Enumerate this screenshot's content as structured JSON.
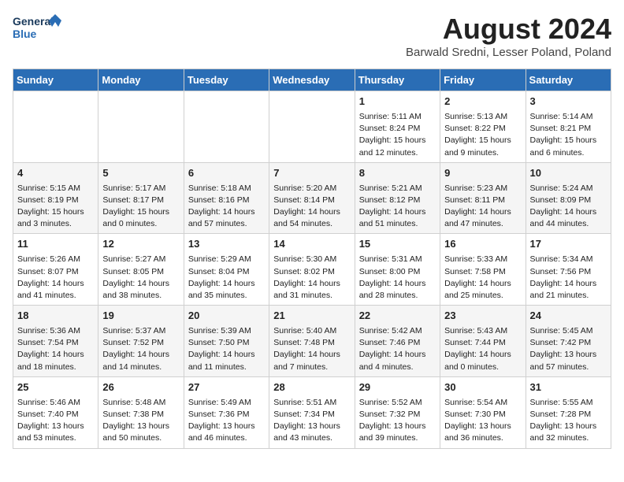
{
  "header": {
    "logo_line1": "General",
    "logo_line2": "Blue",
    "month_title": "August 2024",
    "location": "Barwald Sredni, Lesser Poland, Poland"
  },
  "days_of_week": [
    "Sunday",
    "Monday",
    "Tuesday",
    "Wednesday",
    "Thursday",
    "Friday",
    "Saturday"
  ],
  "weeks": [
    [
      {
        "day": "",
        "info": ""
      },
      {
        "day": "",
        "info": ""
      },
      {
        "day": "",
        "info": ""
      },
      {
        "day": "",
        "info": ""
      },
      {
        "day": "1",
        "info": "Sunrise: 5:11 AM\nSunset: 8:24 PM\nDaylight: 15 hours and 12 minutes."
      },
      {
        "day": "2",
        "info": "Sunrise: 5:13 AM\nSunset: 8:22 PM\nDaylight: 15 hours and 9 minutes."
      },
      {
        "day": "3",
        "info": "Sunrise: 5:14 AM\nSunset: 8:21 PM\nDaylight: 15 hours and 6 minutes."
      }
    ],
    [
      {
        "day": "4",
        "info": "Sunrise: 5:15 AM\nSunset: 8:19 PM\nDaylight: 15 hours and 3 minutes."
      },
      {
        "day": "5",
        "info": "Sunrise: 5:17 AM\nSunset: 8:17 PM\nDaylight: 15 hours and 0 minutes."
      },
      {
        "day": "6",
        "info": "Sunrise: 5:18 AM\nSunset: 8:16 PM\nDaylight: 14 hours and 57 minutes."
      },
      {
        "day": "7",
        "info": "Sunrise: 5:20 AM\nSunset: 8:14 PM\nDaylight: 14 hours and 54 minutes."
      },
      {
        "day": "8",
        "info": "Sunrise: 5:21 AM\nSunset: 8:12 PM\nDaylight: 14 hours and 51 minutes."
      },
      {
        "day": "9",
        "info": "Sunrise: 5:23 AM\nSunset: 8:11 PM\nDaylight: 14 hours and 47 minutes."
      },
      {
        "day": "10",
        "info": "Sunrise: 5:24 AM\nSunset: 8:09 PM\nDaylight: 14 hours and 44 minutes."
      }
    ],
    [
      {
        "day": "11",
        "info": "Sunrise: 5:26 AM\nSunset: 8:07 PM\nDaylight: 14 hours and 41 minutes."
      },
      {
        "day": "12",
        "info": "Sunrise: 5:27 AM\nSunset: 8:05 PM\nDaylight: 14 hours and 38 minutes."
      },
      {
        "day": "13",
        "info": "Sunrise: 5:29 AM\nSunset: 8:04 PM\nDaylight: 14 hours and 35 minutes."
      },
      {
        "day": "14",
        "info": "Sunrise: 5:30 AM\nSunset: 8:02 PM\nDaylight: 14 hours and 31 minutes."
      },
      {
        "day": "15",
        "info": "Sunrise: 5:31 AM\nSunset: 8:00 PM\nDaylight: 14 hours and 28 minutes."
      },
      {
        "day": "16",
        "info": "Sunrise: 5:33 AM\nSunset: 7:58 PM\nDaylight: 14 hours and 25 minutes."
      },
      {
        "day": "17",
        "info": "Sunrise: 5:34 AM\nSunset: 7:56 PM\nDaylight: 14 hours and 21 minutes."
      }
    ],
    [
      {
        "day": "18",
        "info": "Sunrise: 5:36 AM\nSunset: 7:54 PM\nDaylight: 14 hours and 18 minutes."
      },
      {
        "day": "19",
        "info": "Sunrise: 5:37 AM\nSunset: 7:52 PM\nDaylight: 14 hours and 14 minutes."
      },
      {
        "day": "20",
        "info": "Sunrise: 5:39 AM\nSunset: 7:50 PM\nDaylight: 14 hours and 11 minutes."
      },
      {
        "day": "21",
        "info": "Sunrise: 5:40 AM\nSunset: 7:48 PM\nDaylight: 14 hours and 7 minutes."
      },
      {
        "day": "22",
        "info": "Sunrise: 5:42 AM\nSunset: 7:46 PM\nDaylight: 14 hours and 4 minutes."
      },
      {
        "day": "23",
        "info": "Sunrise: 5:43 AM\nSunset: 7:44 PM\nDaylight: 14 hours and 0 minutes."
      },
      {
        "day": "24",
        "info": "Sunrise: 5:45 AM\nSunset: 7:42 PM\nDaylight: 13 hours and 57 minutes."
      }
    ],
    [
      {
        "day": "25",
        "info": "Sunrise: 5:46 AM\nSunset: 7:40 PM\nDaylight: 13 hours and 53 minutes."
      },
      {
        "day": "26",
        "info": "Sunrise: 5:48 AM\nSunset: 7:38 PM\nDaylight: 13 hours and 50 minutes."
      },
      {
        "day": "27",
        "info": "Sunrise: 5:49 AM\nSunset: 7:36 PM\nDaylight: 13 hours and 46 minutes."
      },
      {
        "day": "28",
        "info": "Sunrise: 5:51 AM\nSunset: 7:34 PM\nDaylight: 13 hours and 43 minutes."
      },
      {
        "day": "29",
        "info": "Sunrise: 5:52 AM\nSunset: 7:32 PM\nDaylight: 13 hours and 39 minutes."
      },
      {
        "day": "30",
        "info": "Sunrise: 5:54 AM\nSunset: 7:30 PM\nDaylight: 13 hours and 36 minutes."
      },
      {
        "day": "31",
        "info": "Sunrise: 5:55 AM\nSunset: 7:28 PM\nDaylight: 13 hours and 32 minutes."
      }
    ]
  ]
}
